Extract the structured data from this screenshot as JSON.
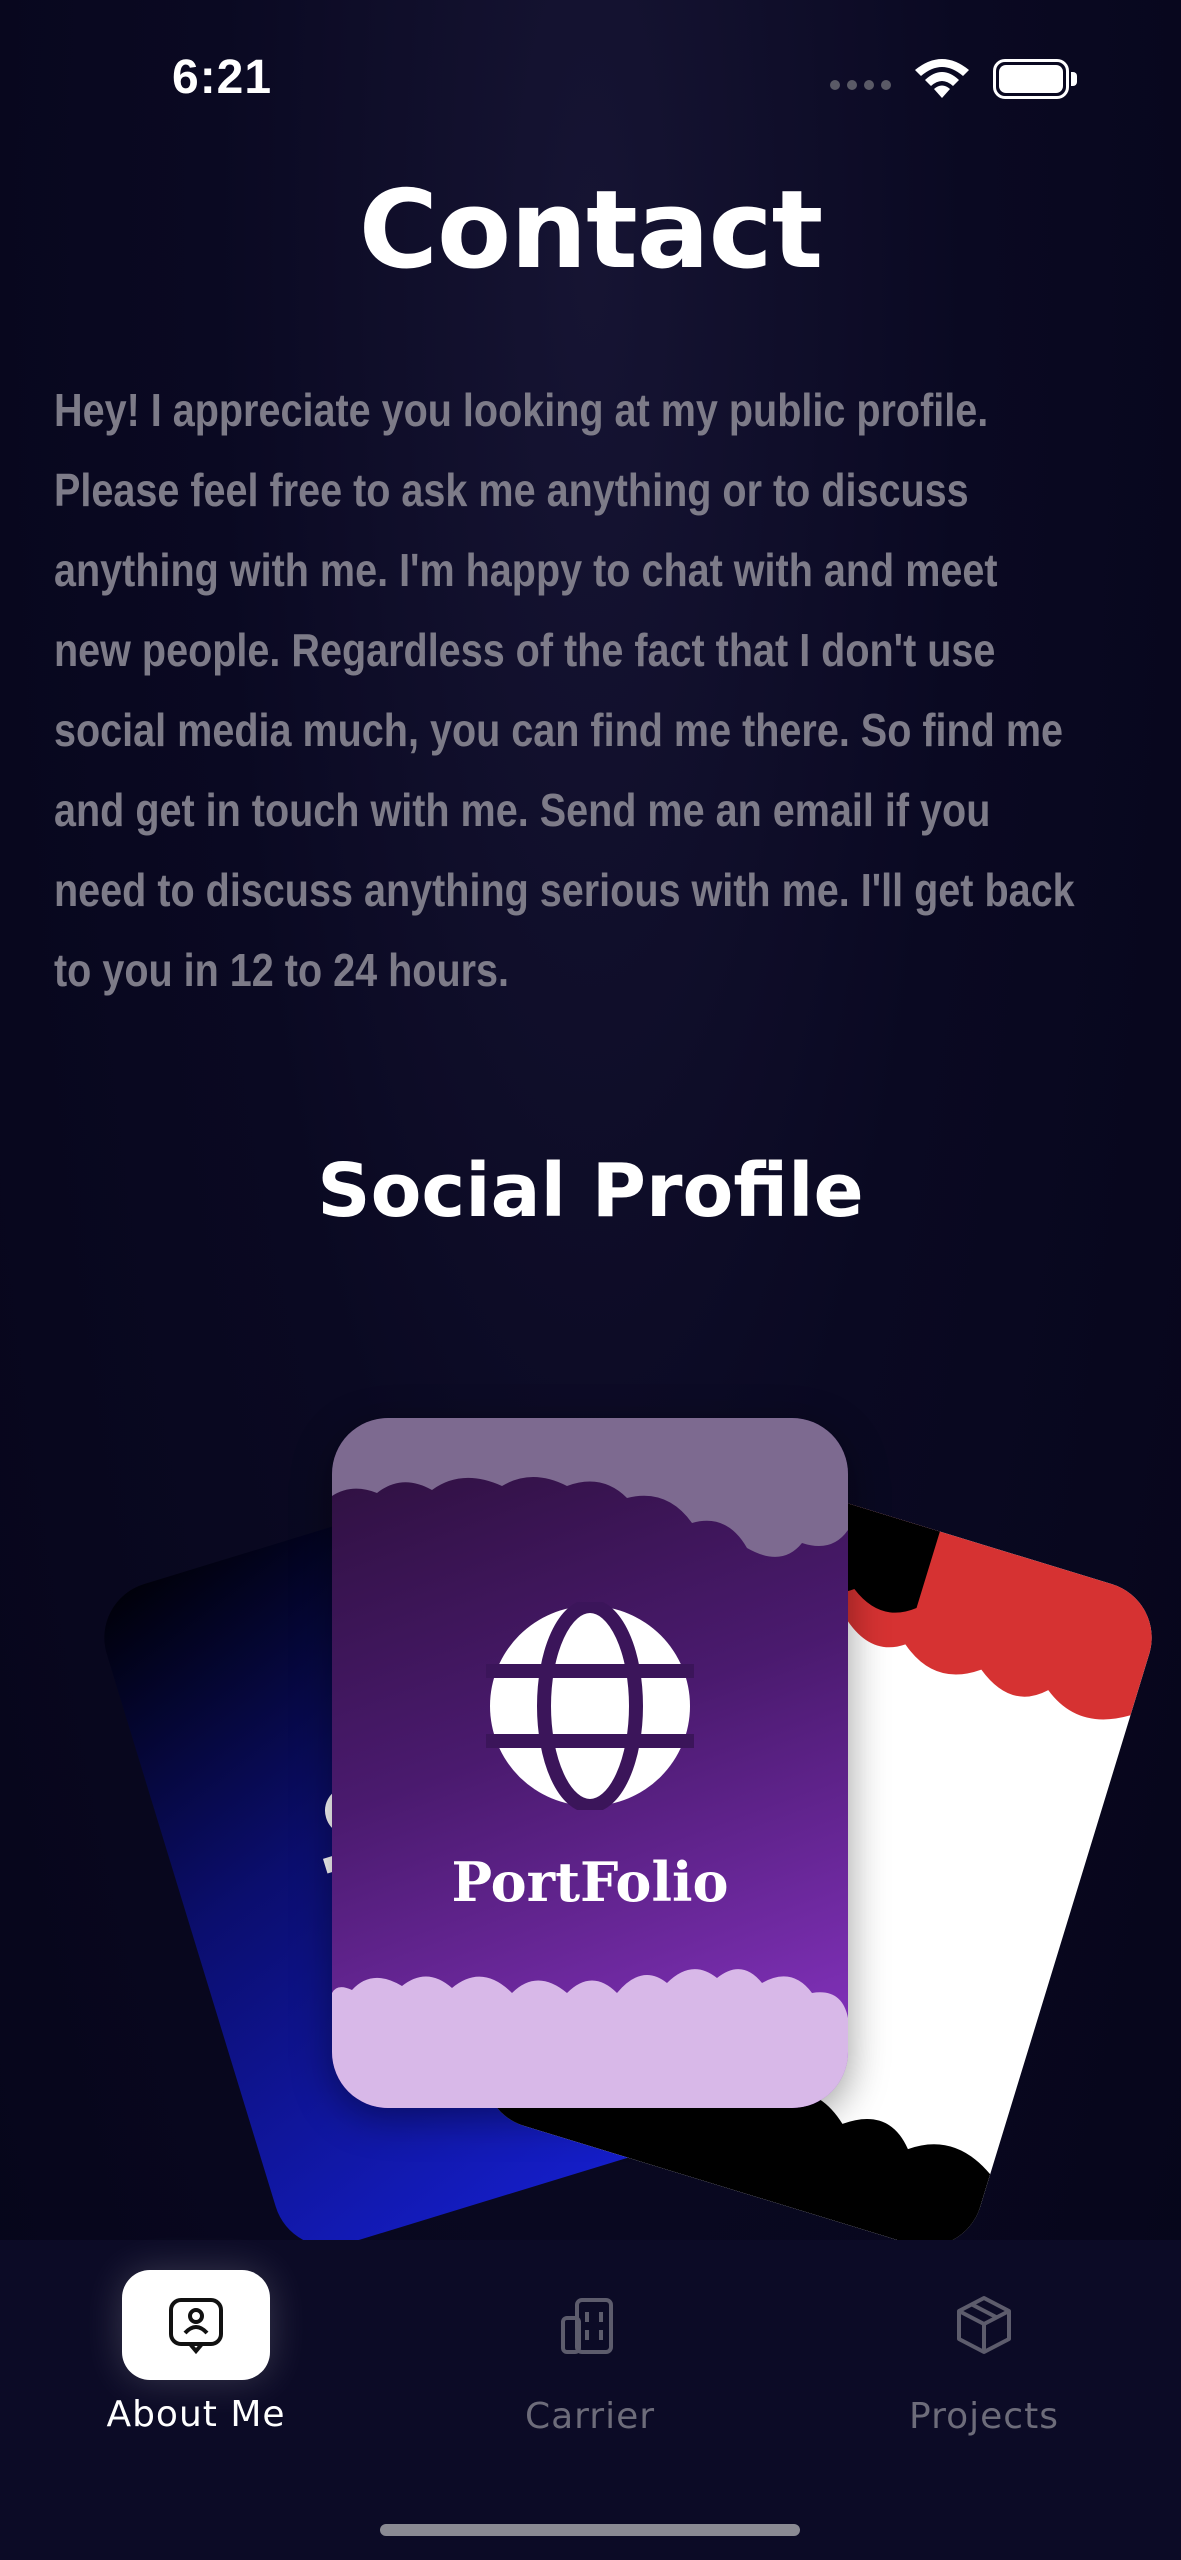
{
  "status_bar": {
    "time": "6:21",
    "icons": [
      "signal-dots-icon",
      "wifi-icon",
      "battery-icon"
    ]
  },
  "contact": {
    "title": "Contact",
    "body_lines": [
      "Hey! I appreciate you looking at my public profile.",
      "Please feel free to ask me anything or to discuss",
      "anything with me. I'm happy to chat with and meet",
      "new people. Regardless of the fact that I don't use",
      "social media much, you can find me there. So find me",
      "and get in touch with me. Send me an email if you",
      "need to discuss anything serious with me. I'll get back",
      "to you in 12 to 24 hours."
    ]
  },
  "social_profile": {
    "title": "Social Profile",
    "cards": {
      "left": {
        "letter": "i",
        "icon": "linkedin-logo-icon"
      },
      "center": {
        "label": "PortFolio",
        "icon": "globe-icon"
      },
      "right": {
        "icon": "social-card-icon"
      }
    }
  },
  "tab_bar": {
    "tabs": [
      {
        "label": "About Me",
        "icon": "profile-badge-icon",
        "active": true
      },
      {
        "label": "Carrier",
        "icon": "building-icon",
        "active": false
      },
      {
        "label": "Projects",
        "icon": "box-icon",
        "active": false
      }
    ]
  },
  "colors": {
    "background": "#07061a",
    "body_text": "#7d7b88",
    "accent_purple": "#8b35c8",
    "card_blue": "#1620d6",
    "card_red": "#d63232",
    "tab_bar": "#0c0b26"
  }
}
